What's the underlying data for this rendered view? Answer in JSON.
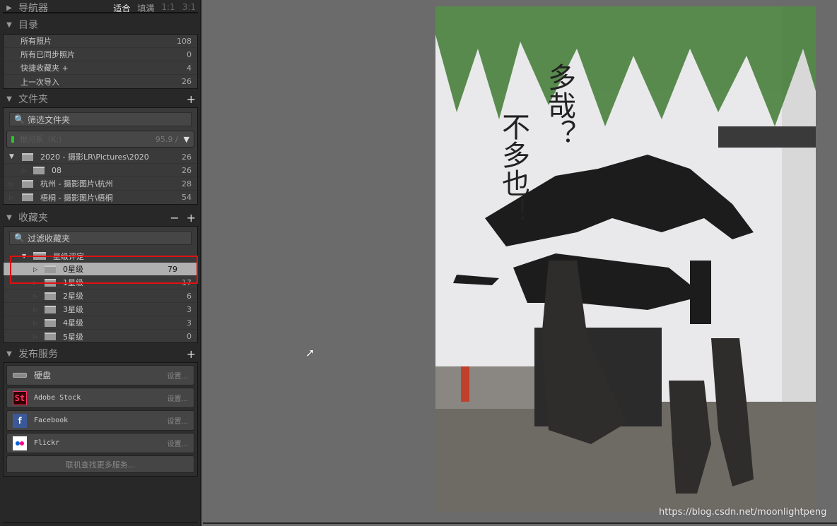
{
  "navigator": {
    "title": "导航器",
    "options": [
      "适合",
      "填满",
      "1:1",
      "3:1"
    ]
  },
  "catalog": {
    "title": "目录",
    "items": [
      {
        "label": "所有照片",
        "count": "108"
      },
      {
        "label": "所有已同步照片",
        "count": "0"
      },
      {
        "label": "快捷收藏夹 +",
        "count": "4"
      },
      {
        "label": "上一次导入",
        "count": "26"
      }
    ]
  },
  "folders": {
    "title": "文件夹",
    "filter_placeholder": "筛选文件夹",
    "volume": {
      "name": "根河系（K:）",
      "space": "95.9 /"
    },
    "items": [
      {
        "label": "2020 - 摄影LR\\Pictures\\2020",
        "count": "26"
      },
      {
        "label": "08",
        "count": "26"
      },
      {
        "label": "杭州 - 摄影图片\\杭州",
        "count": "28"
      },
      {
        "label": "梧桐 - 摄影图片\\梧桐",
        "count": "54"
      }
    ]
  },
  "collections": {
    "title": "收藏夹",
    "filter_placeholder": "过滤收藏夹",
    "set": "星级评定",
    "items": [
      {
        "label": "0星级",
        "count": "79"
      },
      {
        "label": "1星级",
        "count": "17"
      },
      {
        "label": "2星级",
        "count": "6"
      },
      {
        "label": "3星级",
        "count": "3"
      },
      {
        "label": "4星级",
        "count": "3"
      },
      {
        "label": "5星级",
        "count": "0"
      }
    ]
  },
  "publish": {
    "title": "发布服务",
    "services": [
      {
        "label": "硬盘",
        "setting": "设置..."
      },
      {
        "label": "Adobe Stock",
        "setting": "设置..."
      },
      {
        "label": "Facebook",
        "setting": "设置..."
      },
      {
        "label": "Flickr",
        "setting": "设置..."
      }
    ],
    "more": "联机查找更多服务..."
  },
  "photo": {
    "wall_text": [
      "不多也！",
      "多哉？"
    ]
  },
  "watermark": "https://blog.csdn.net/moonlightpeng"
}
